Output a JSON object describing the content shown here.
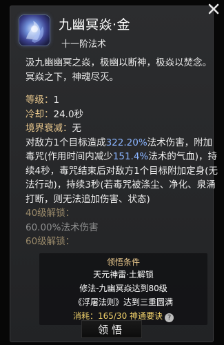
{
  "skill": {
    "name": "九幽冥焱·金",
    "rank": "十一阶法术",
    "description": "汲九幽幽冥之焱，极幽以断神，极焱以焚念。冥焱之下，神魂尽灭。"
  },
  "stats": {
    "level_label": "等级：",
    "level_value": "1",
    "cooldown_label": "冷却：",
    "cooldown_value": "24.0秒",
    "realm_decay_label": "境界衰减：",
    "realm_decay_value": "无"
  },
  "effect": {
    "part1": "对敌方1个目标造成",
    "value1": "322.20%",
    "part2": "法术伤害，附加毒咒(作用时间内减少",
    "value2": "151.4%",
    "part3": "法术的气血)，持续4秒，毒咒结束后对敌方1个目标附加定身(无法行动)，持续3秒(若毒咒被涤尘、净化、泉涌打断，则无法追加伤害、状态)"
  },
  "unlocks": {
    "lv40_label": "40级解锁：",
    "lv40_text": "60.00%法术伤害",
    "lv60_label": "60级解锁："
  },
  "conditions": {
    "title": "领悟条件",
    "line1": "天元神雷·土解锁",
    "line2": "修法-九幽冥焱达到80级",
    "line3": "《浮屠法则》达到三重圆满",
    "cost_label": "消耗：",
    "cost_value": "165/30 神通要诀"
  },
  "buttons": {
    "comprehend": "领悟"
  },
  "colors": {
    "label_gold": "#e9c88d",
    "highlight_blue": "#8ab4ff",
    "cost_yellow": "#f3d36b"
  },
  "icons": {
    "close": "close-x-icon",
    "skill": "ghost-flame-skill-icon",
    "help": "question-mark-icon"
  }
}
